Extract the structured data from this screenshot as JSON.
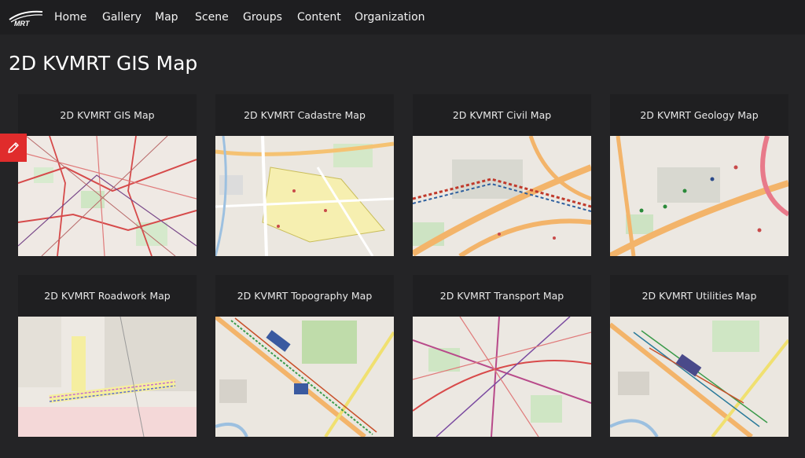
{
  "header": {
    "logo_text": "MRT",
    "nav": [
      "Home",
      "Gallery",
      "Map",
      "Scene",
      "Groups",
      "Content",
      "Organization"
    ]
  },
  "page": {
    "title": "2D KVMRT GIS Map"
  },
  "edit_tab": {
    "icon": "pencil-icon",
    "color": "#e02c2c"
  },
  "cards": [
    {
      "title": "2D KVMRT GIS Map"
    },
    {
      "title": "2D KVMRT Cadastre Map"
    },
    {
      "title": "2D KVMRT Civil Map"
    },
    {
      "title": "2D KVMRT Geology Map"
    },
    {
      "title": "2D KVMRT Roadwork Map"
    },
    {
      "title": "2D KVMRT Topography Map"
    },
    {
      "title": "2D KVMRT Transport Map"
    },
    {
      "title": "2D KVMRT Utilities Map"
    }
  ]
}
